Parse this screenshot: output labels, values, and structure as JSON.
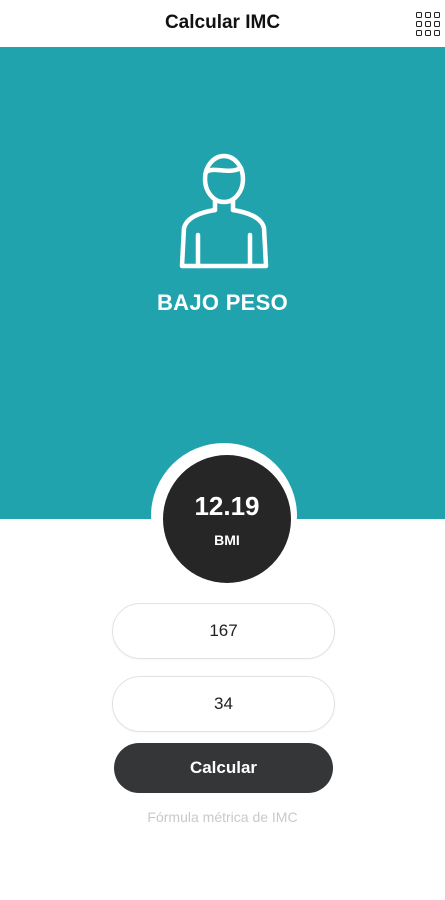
{
  "header": {
    "title": "Calcular IMC",
    "menu_icon": "grid-icon"
  },
  "hero": {
    "background_color": "#21a3ae",
    "icon": "person-icon",
    "status": "BAJO PESO"
  },
  "result": {
    "value": "12.19",
    "label": "BMI"
  },
  "form": {
    "height_value": "167",
    "weight_value": "34",
    "calculate_label": "Calcular",
    "formula_link": "Fórmula métrica de IMC"
  },
  "colors": {
    "accent": "#21a3ae",
    "dark": "#262626",
    "button": "#353638"
  }
}
